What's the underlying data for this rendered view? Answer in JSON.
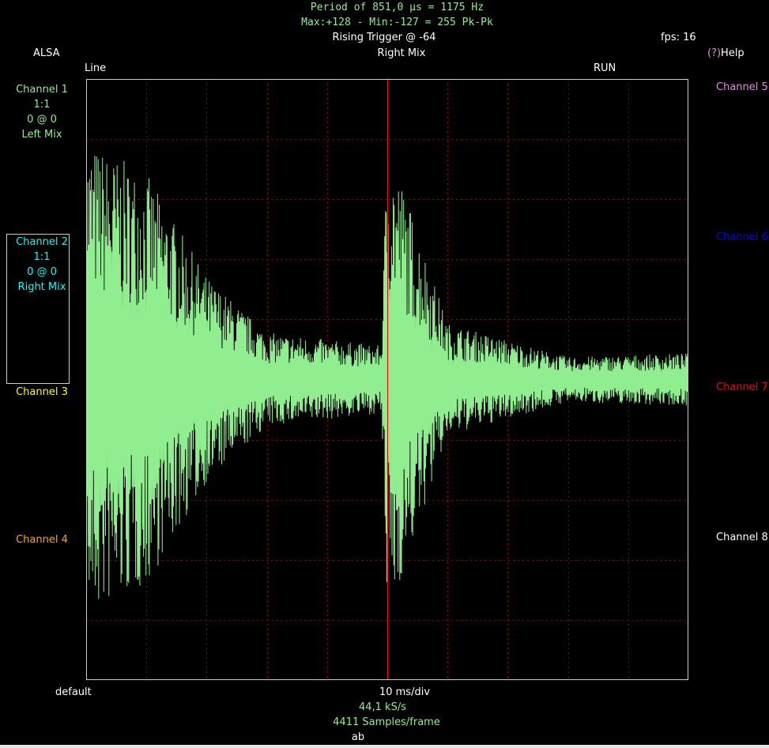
{
  "header": {
    "measurement_line1": "Period of 851,0 µs =  1175 Hz",
    "measurement_line2": "Max:+128 - Min:-127 = 255 Pk-Pk",
    "trigger": "Rising Trigger @ -64",
    "fps": "fps: 16",
    "input_source": "ALSA",
    "channel_title": "Right Mix",
    "help": "(?)Help",
    "line_mode": "Line",
    "run_state": "RUN"
  },
  "left_channels": [
    {
      "name": "Channel 1",
      "scale": "1:1",
      "offset": "0 @ 0",
      "source": "Left Mix",
      "color": "#90ee90"
    },
    {
      "name": "Channel 2",
      "scale": "1:1",
      "offset": "0 @ 0",
      "source": "Right Mix",
      "color": "#00ffff"
    },
    {
      "name": "Channel 3",
      "color": "#ffff00"
    },
    {
      "name": "Channel 4",
      "color": "#ffa500"
    }
  ],
  "right_channels": [
    {
      "name": "Channel 5",
      "color": "#ee82ee"
    },
    {
      "name": "Channel 6",
      "color": "#0000ff"
    },
    {
      "name": "Channel 7",
      "color": "#ff0000"
    },
    {
      "name": "Channel 8",
      "color": "#ffffff"
    }
  ],
  "footer": {
    "preset": "default",
    "timebase": "10 ms/div",
    "sample_rate": "44,1 kS/s",
    "samples_per_frame": "4411 Samples/frame",
    "extra": "ab"
  },
  "colors": {
    "background": "#000000",
    "trace": "#90ee90",
    "grid": "#8b0000",
    "trigger_marker": "#ff0000",
    "border": "#cccccc"
  },
  "chart_data": {
    "type": "line",
    "grid_divisions": {
      "x": 10,
      "y": 10
    },
    "amplitude_range": [
      -128,
      128
    ],
    "trace_name": "Right Mix",
    "envelope": [
      {
        "t": 0.0,
        "amp": 128
      },
      {
        "t": 0.1,
        "amp": 110
      },
      {
        "t": 0.2,
        "amp": 55
      },
      {
        "t": 0.3,
        "amp": 25
      },
      {
        "t": 0.49,
        "amp": 18
      },
      {
        "t": 0.5,
        "amp": 128
      },
      {
        "t": 0.53,
        "amp": 100
      },
      {
        "t": 0.6,
        "amp": 30
      },
      {
        "t": 0.8,
        "amp": 12
      },
      {
        "t": 1.0,
        "amp": 14
      }
    ]
  }
}
